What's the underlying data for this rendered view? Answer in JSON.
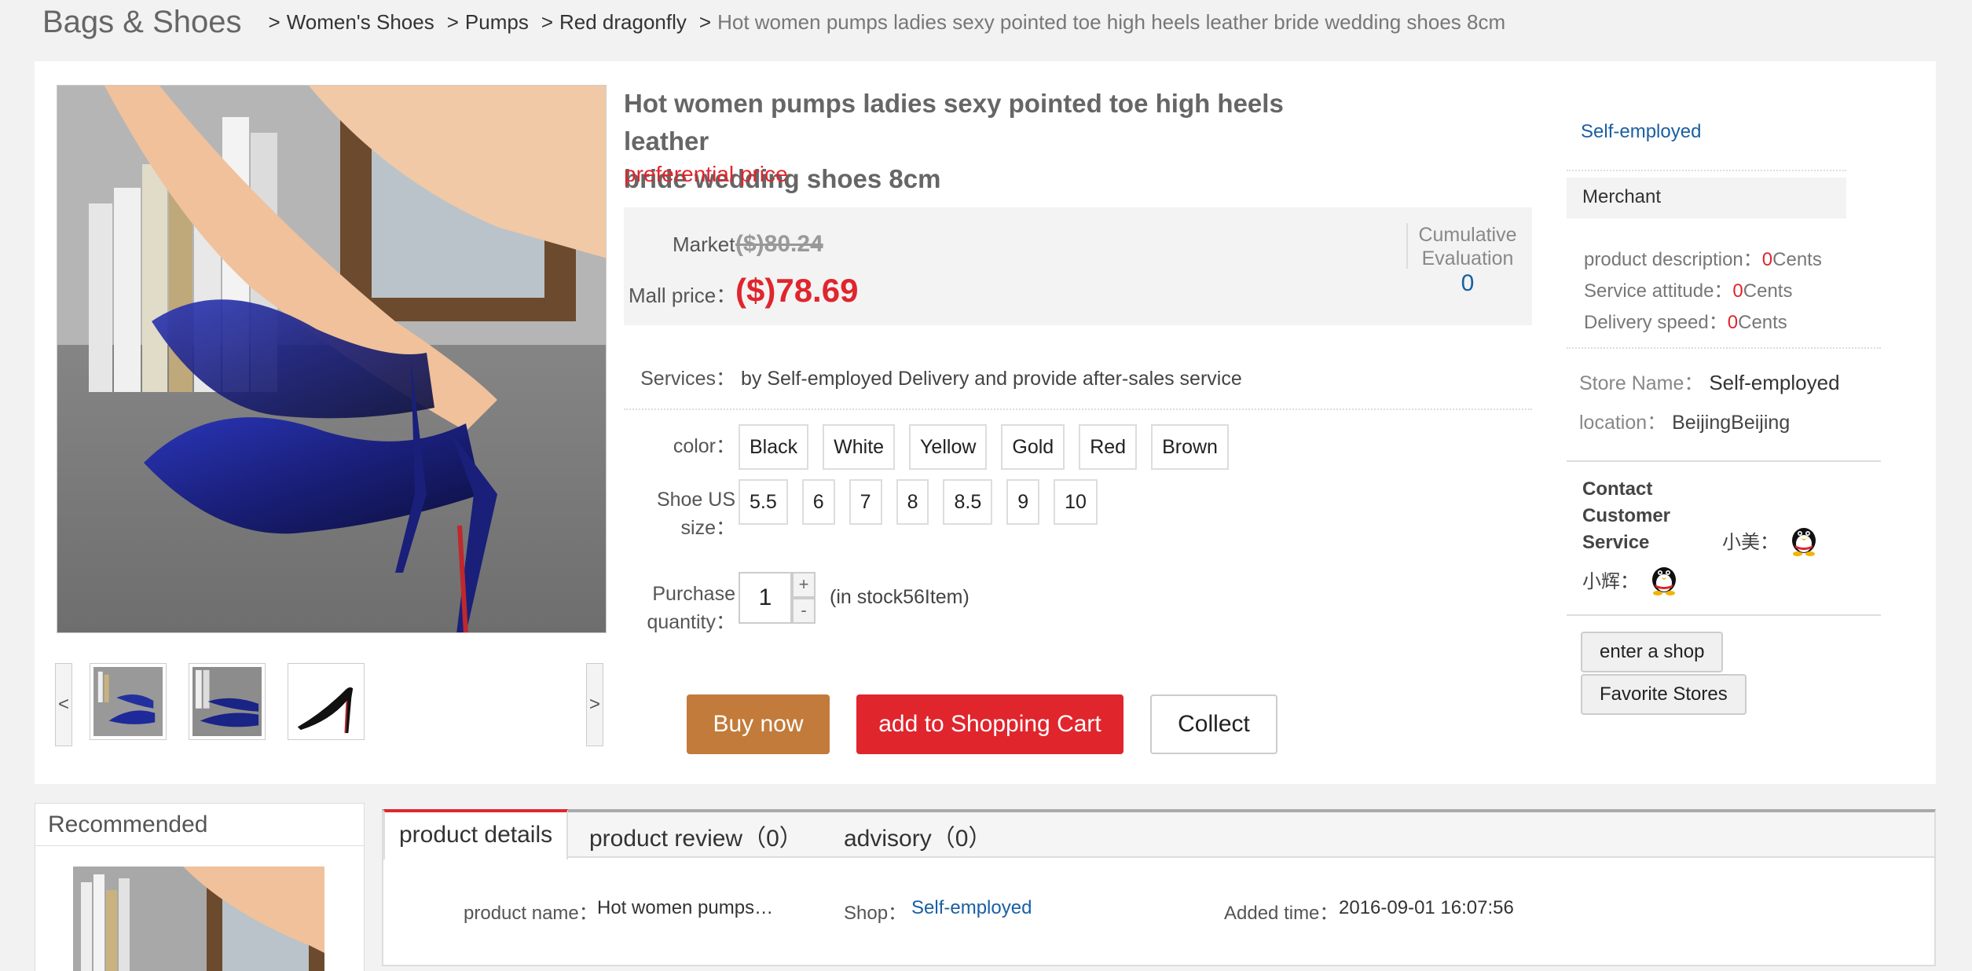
{
  "breadcrumb": {
    "category": "Bags & Shoes",
    "items": [
      "Women's Shoes",
      "Pumps",
      "Red dragonfly"
    ],
    "current": "Hot women pumps ladies sexy pointed toe high heels leather bride wedding shoes 8cm",
    "separator": ">"
  },
  "product": {
    "title_line1": "Hot women pumps ladies sexy pointed toe high heels leather",
    "title_line2": "bride wedding shoes 8cm",
    "promo": "preferential price",
    "market_label": "Market",
    "market_price": "($)80.24",
    "mall_label": "Mall price：",
    "mall_price": "($)78.69",
    "cumulative_label_1": "Cumulative",
    "cumulative_label_2": "Evaluation",
    "cumulative_value": "0",
    "services_label": "Services：",
    "services_text": "by Self-employed Delivery and provide after-sales service",
    "color_label": "color：",
    "colors": [
      "Black",
      "White",
      "Yellow",
      "Gold",
      "Red",
      "Brown"
    ],
    "size_label_1": "Shoe US",
    "size_label_2": "size：",
    "sizes": [
      "5.5",
      "6",
      "7",
      "8",
      "8.5",
      "9",
      "10"
    ],
    "qty_label_1": "Purchase",
    "qty_label_2": "quantity：",
    "qty_value": "1",
    "qty_plus": "+",
    "qty_minus": "-",
    "stock_text": "(in stock56Item)",
    "buy_label": "Buy now",
    "cart_label": "add to Shopping Cart",
    "collect_label": "Collect",
    "thumb_prev": "<",
    "thumb_next": ">"
  },
  "store": {
    "link": "Self-employed",
    "merchant": "Merchant",
    "scores": [
      {
        "label": "product description：",
        "value": "0",
        "unit": "Cents"
      },
      {
        "label": "Service attitude：",
        "value": "0",
        "unit": "Cents"
      },
      {
        "label": "Delivery speed：",
        "value": "0",
        "unit": "Cents"
      }
    ],
    "store_name_label": "Store Name：",
    "store_name": "Self-employed",
    "location_label": "location：",
    "location": "BeijingBeijing",
    "contact_1": "Contact",
    "contact_2": "Customer",
    "contact_3": "Service",
    "cs1": "小美：",
    "cs2": "小辉：",
    "enter_label": "enter a shop",
    "fav_label": "Favorite Stores"
  },
  "recommended": {
    "title": "Recommended"
  },
  "tabs": {
    "details": "product details",
    "review": "product review（0）",
    "advisory": "advisory（0）"
  },
  "details": {
    "name_label": "product name：",
    "name_value": "Hot women pumps…",
    "shop_label": "Shop：",
    "shop_value": "Self-employed",
    "added_label": "Added time：",
    "added_value": "2016-09-01 16:07:56"
  },
  "colors": {
    "accent_red": "#e0252d",
    "buy_brown": "#c27b3a",
    "link_blue": "#1a5fa3"
  }
}
